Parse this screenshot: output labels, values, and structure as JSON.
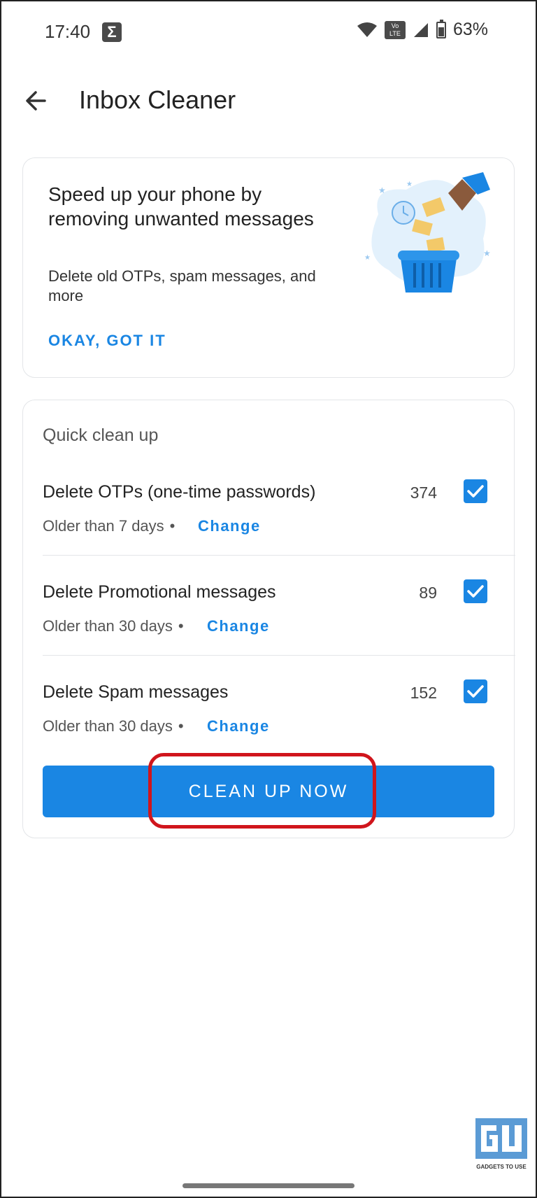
{
  "status_bar": {
    "time": "17:40",
    "notification_icon": "sigma-icon",
    "volte_top": "Vo",
    "volte_bottom": "LTE",
    "battery_percent": "63%",
    "battery_level": 0.63
  },
  "header": {
    "back_icon": "arrow-back-icon",
    "title": "Inbox Cleaner"
  },
  "intro_card": {
    "title": "Speed up your phone by removing unwanted messages",
    "description": "Delete old OTPs, spam messages, and more",
    "dismiss_label": "OKAY, GOT IT",
    "illustration": "trash-bin-messages-illustration"
  },
  "quick_clean": {
    "section_label": "Quick clean up",
    "items": [
      {
        "title": "Delete OTPs (one-time passwords)",
        "age": "Older than 7 days",
        "change_label": "Change",
        "count": "374",
        "checked": true
      },
      {
        "title": "Delete Promotional messages",
        "age": "Older than 30 days",
        "change_label": "Change",
        "count": "89",
        "checked": true
      },
      {
        "title": "Delete Spam messages",
        "age": "Older than 30 days",
        "change_label": "Change",
        "count": "152",
        "checked": true
      }
    ],
    "separator": "•",
    "action_label": "CLEAN UP NOW"
  },
  "watermark": {
    "text": "GADGETS TO USE"
  },
  "colors": {
    "accent": "#1a86e3",
    "highlight": "#d0151c"
  }
}
